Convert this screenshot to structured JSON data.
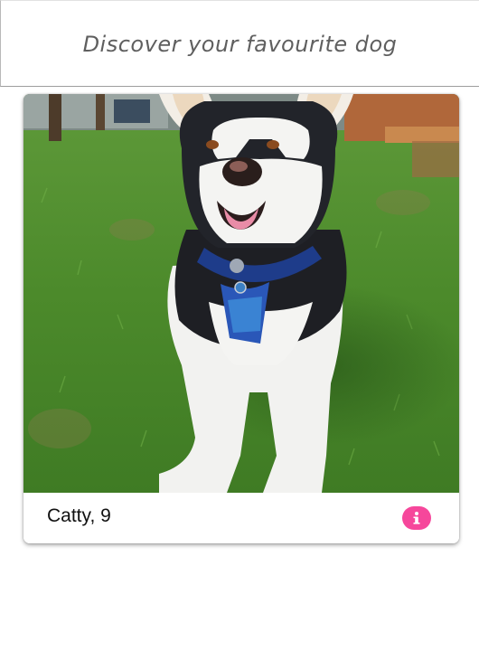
{
  "header": {
    "title": "Discover your favourite dog"
  },
  "card": {
    "photo_description_icon": "dog-photo",
    "caption": "Catty, 9",
    "info_icon": "info-icon",
    "info_color": "#f6479b"
  }
}
